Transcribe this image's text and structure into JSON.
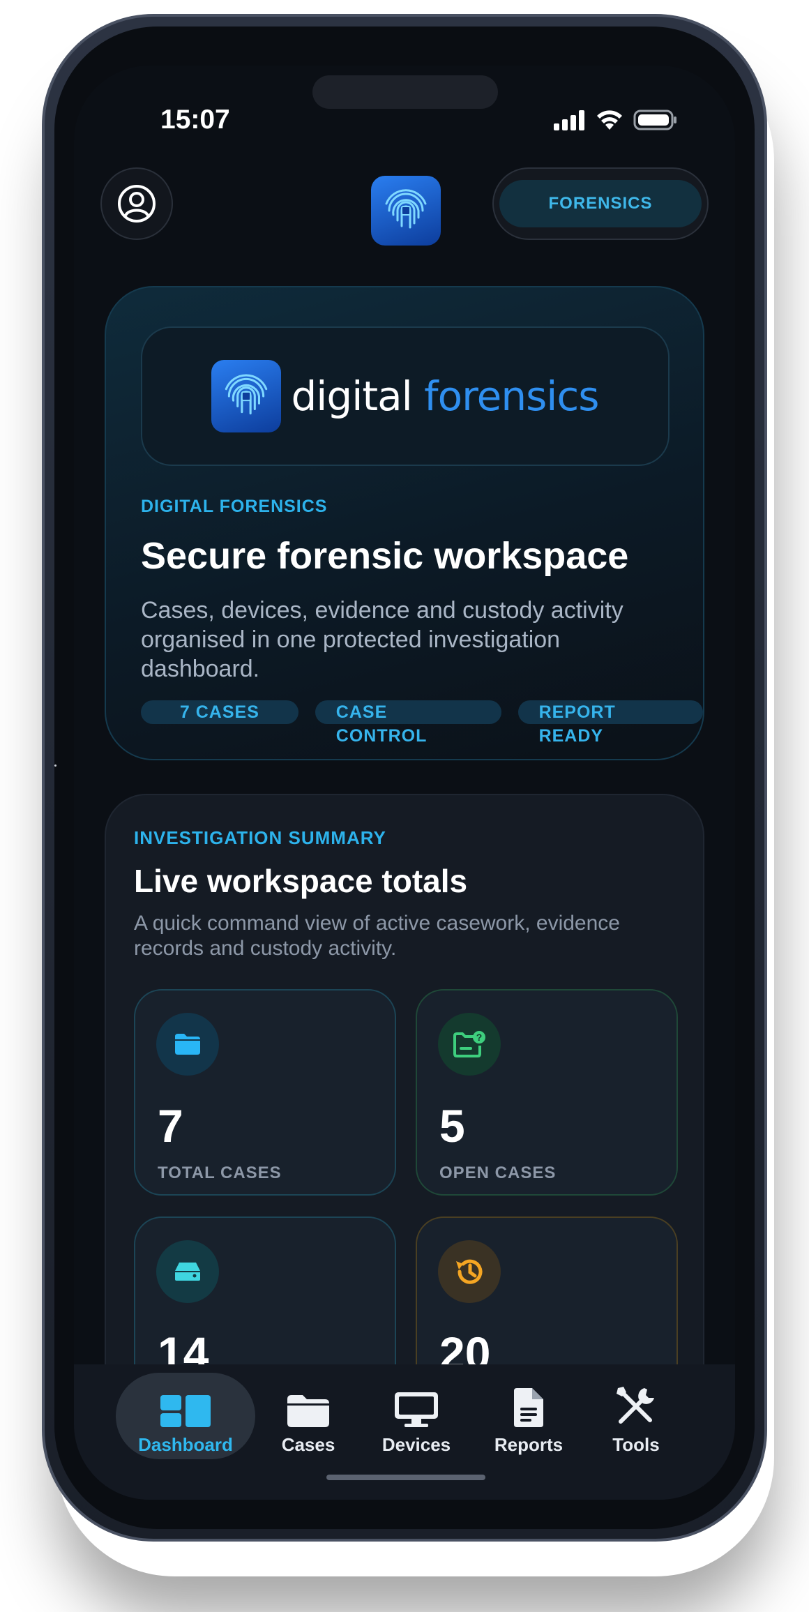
{
  "status_bar": {
    "time": "15:07"
  },
  "header": {
    "badge_label": "FORENSICS"
  },
  "hero": {
    "brand_word_1": "digital",
    "brand_word_2": "forensics",
    "kicker": "DIGITAL FORENSICS",
    "title": "Secure forensic workspace",
    "description": "Cases, devices, evidence and custody activity organised in one protected investigation dashboard.",
    "tags": [
      "7 CASES",
      "CASE CONTROL",
      "REPORT READY"
    ]
  },
  "summary": {
    "kicker": "INVESTIGATION SUMMARY",
    "title": "Live workspace totals",
    "description": "A quick command view of active casework, evidence records and custody activity.",
    "stats": [
      {
        "value": "7",
        "label": "TOTAL CASES",
        "icon": "folder-icon",
        "color": "#29b6f6"
      },
      {
        "value": "5",
        "label": "OPEN CASES",
        "icon": "folder-question-icon",
        "color": "#3ecf7e"
      },
      {
        "value": "14",
        "label": "",
        "icon": "hard-drive-icon",
        "color": "#3fd6e0"
      },
      {
        "value": "20",
        "label": "",
        "icon": "history-icon",
        "color": "#f5a623"
      }
    ]
  },
  "tab_bar": {
    "items": [
      {
        "label": "Dashboard",
        "icon": "dashboard-icon",
        "active": true
      },
      {
        "label": "Cases",
        "icon": "folder-icon"
      },
      {
        "label": "Devices",
        "icon": "monitor-icon"
      },
      {
        "label": "Reports",
        "icon": "document-icon"
      },
      {
        "label": "Tools",
        "icon": "tools-icon"
      }
    ]
  },
  "colors": {
    "accent": "#2db3ec",
    "background": "#0b0f15",
    "card": "#151b24"
  }
}
